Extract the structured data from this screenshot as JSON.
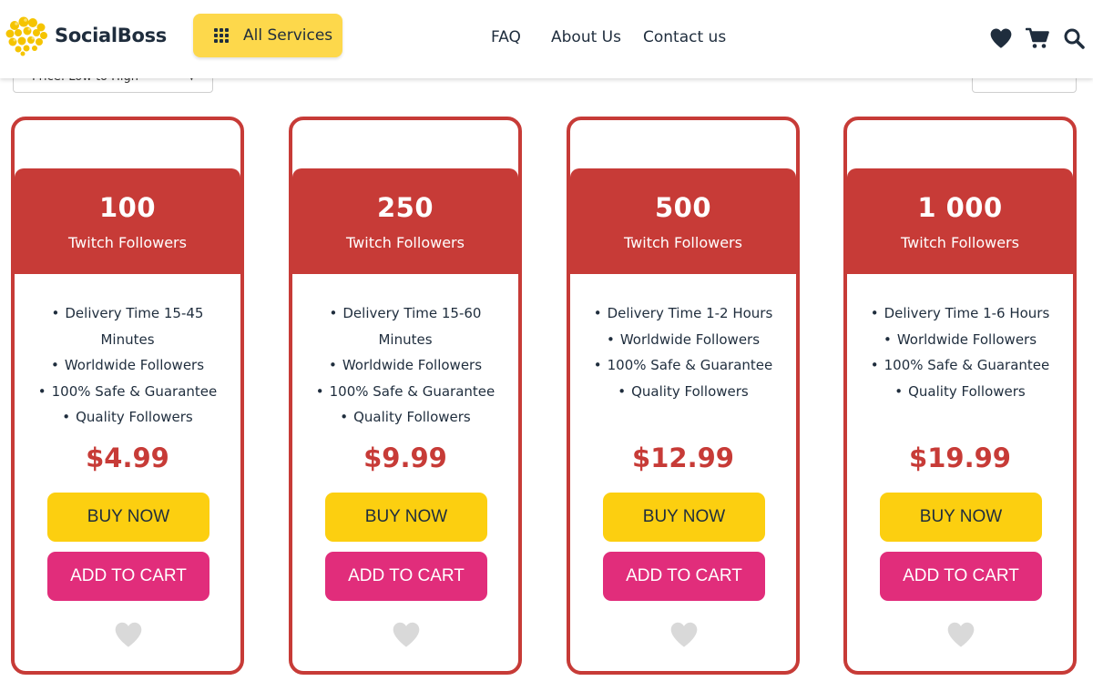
{
  "header": {
    "brand": "SocialBoss",
    "all_services_label": "All Services",
    "nav": {
      "faq": "FAQ",
      "about": "About Us",
      "contact": "Contact us"
    },
    "icons": [
      "heart-icon",
      "cart-icon",
      "search-icon"
    ]
  },
  "toolbar": {
    "sort_label": "Price: Low to High",
    "filter_label": ""
  },
  "products": [
    {
      "quantity": "100",
      "service": "Twitch Followers",
      "features": [
        "Delivery Time 15-45 Minutes",
        "Worldwide Followers",
        "100% Safe & Guarantee",
        "Quality Followers"
      ],
      "price": "$4.99",
      "buy_label": "BUY NOW",
      "cart_label": "ADD TO CART"
    },
    {
      "quantity": "250",
      "service": "Twitch Followers",
      "features": [
        "Delivery Time 15-60 Minutes",
        "Worldwide Followers",
        "100% Safe & Guarantee",
        "Quality Followers"
      ],
      "price": "$9.99",
      "buy_label": "BUY NOW",
      "cart_label": "ADD TO CART"
    },
    {
      "quantity": "500",
      "service": "Twitch Followers",
      "features": [
        "Delivery Time 1-2 Hours",
        "Worldwide Followers",
        "100% Safe & Guarantee",
        "Quality Followers"
      ],
      "price": "$12.99",
      "buy_label": "BUY NOW",
      "cart_label": "ADD TO CART"
    },
    {
      "quantity": "1 000",
      "service": "Twitch Followers",
      "features": [
        "Delivery Time 1-6 Hours",
        "Worldwide Followers",
        "100% Safe & Guarantee",
        "Quality Followers"
      ],
      "price": "$19.99",
      "buy_label": "BUY NOW",
      "cart_label": "ADD TO CART"
    }
  ],
  "colors": {
    "brand_yellow": "#fdd84b",
    "buy_yellow": "#fccf10",
    "card_red": "#c73b37",
    "cart_pink": "#e12d7b",
    "text_dark": "#1f2d3d",
    "fav_grey": "#d9d9d9"
  }
}
